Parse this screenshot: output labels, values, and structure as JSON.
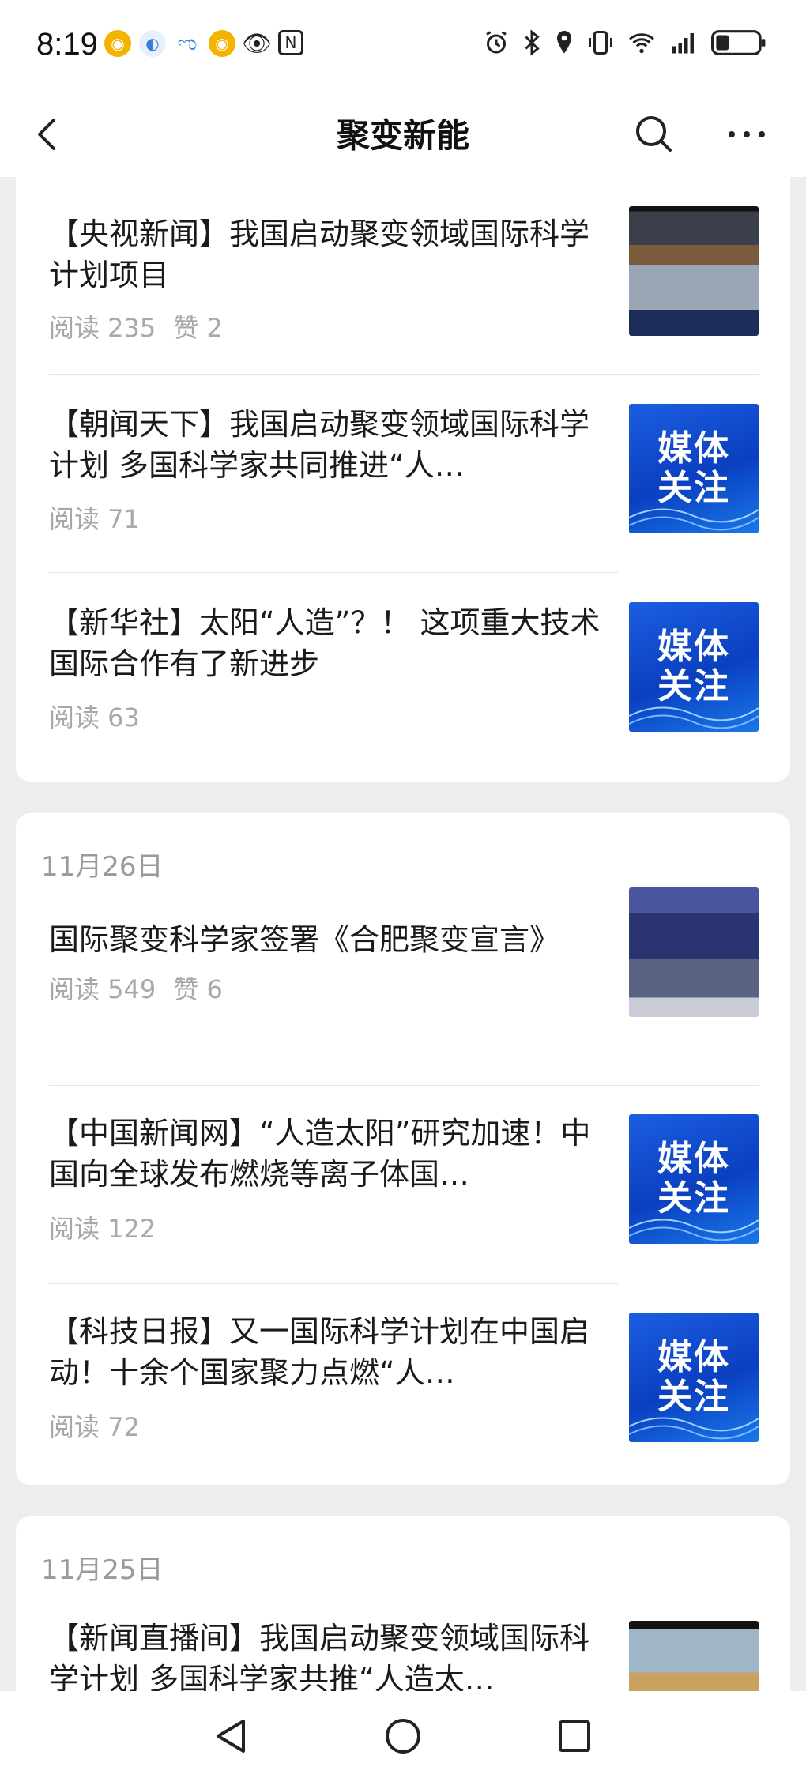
{
  "status_bar": {
    "time": "8:19",
    "left_icons": [
      "weibo-icon",
      "app-icon",
      "chat-icon",
      "weibo-icon",
      "eye-icon",
      "nfc-icon"
    ],
    "right_icons": [
      "alarm-icon",
      "bluetooth-icon",
      "location-icon",
      "vibrate-icon",
      "wifi-icon",
      "signal-icon",
      "battery-icon"
    ]
  },
  "nav": {
    "title": "聚变新能"
  },
  "sections": [
    {
      "date": "",
      "articles": [
        {
          "title": "【央视新闻】我国启动聚变领域国际科学计划项目",
          "reads": "阅读 235",
          "likes": "赞 2",
          "thumb": "photo"
        },
        {
          "title": "【朝闻天下】我国启动聚变领域国际科学计划 多国科学家共同推进“人…",
          "reads": "阅读 71",
          "likes": "",
          "thumb": "media"
        },
        {
          "title": "【新华社】太阳“人造”？！ 这项重大技术国际合作有了新进步",
          "reads": "阅读 63",
          "likes": "",
          "thumb": "media"
        }
      ]
    },
    {
      "date": "11月26日",
      "articles": [
        {
          "title": "国际聚变科学家签署《合肥聚变宣言》",
          "reads": "阅读 549",
          "likes": "赞 6",
          "thumb": "photo"
        },
        {
          "title": "【中国新闻网】“人造太阳”研究加速！中国向全球发布燃烧等离子体国…",
          "reads": "阅读 122",
          "likes": "",
          "thumb": "media"
        },
        {
          "title": "【科技日报】又一国际科学计划在中国启动！十余个国家聚力点燃“人…",
          "reads": "阅读 72",
          "likes": "",
          "thumb": "media"
        }
      ]
    },
    {
      "date": "11月25日",
      "articles": [
        {
          "title": "【新闻直播间】我国启动聚变领域国际科学计划 多国科学家共推“人造太…",
          "reads": "",
          "likes": "",
          "thumb": "photo"
        }
      ]
    }
  ],
  "media_thumb_text": {
    "line1": "媒体",
    "line2": "关注"
  },
  "colors": {
    "accent_blue": "#1b5fe0",
    "meta_gray": "#a8a8a8",
    "background": "#ededed"
  }
}
